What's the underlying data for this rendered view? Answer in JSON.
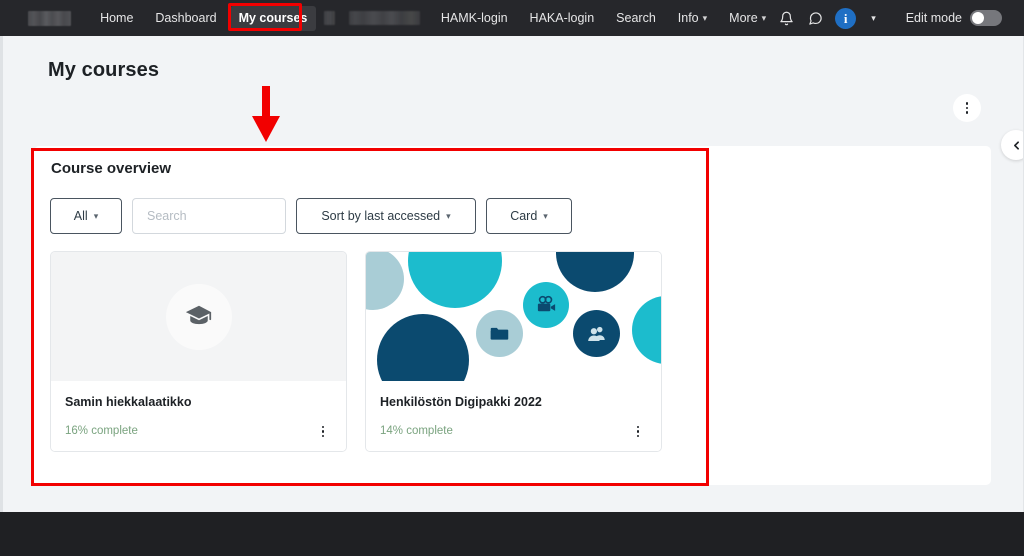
{
  "navbar": {
    "brand": {
      "icon": "redacted-logo-block",
      "redacted": true
    },
    "items": [
      {
        "label": "Home",
        "active": false,
        "has_caret": false
      },
      {
        "label": "Dashboard",
        "active": false,
        "has_caret": false
      },
      {
        "label": "My courses",
        "active": true,
        "has_caret": false
      },
      {
        "label": "HAMK-login",
        "active": false,
        "has_caret": false
      },
      {
        "label": "HAKA-login",
        "active": false,
        "has_caret": false
      },
      {
        "label": "Search",
        "active": false,
        "has_caret": false
      },
      {
        "label": "Info",
        "active": false,
        "has_caret": true
      },
      {
        "label": "More",
        "active": false,
        "has_caret": true
      }
    ],
    "redacted_item": {
      "redacted": true
    },
    "notifications_icon": "bell-icon",
    "messages_icon": "speech-bubble-icon",
    "avatar": {
      "letter": "i",
      "color": "#1f6fc4"
    },
    "avatar_caret": "⌄",
    "edit_mode": {
      "label": "Edit mode",
      "enabled": false
    }
  },
  "page": {
    "title": "My courses",
    "kebab_icon": "kebab-menu-icon",
    "drawer_toggle_icon": "chevron-left-icon"
  },
  "overview": {
    "title": "Course overview",
    "filter_all": {
      "label": "All",
      "caret": "⌄"
    },
    "search": {
      "value": "",
      "placeholder": "Search"
    },
    "sort": {
      "label": "Sort by last accessed",
      "caret": "⌄"
    },
    "view": {
      "label": "Card",
      "caret": "⌄"
    },
    "cards": [
      {
        "title": "Samin hiekkalaatikko",
        "progress": "16% complete",
        "image_type": "placeholder-graduation-cap",
        "image_icon": "graduation-cap-icon",
        "kebab_icon": "kebab-menu-icon"
      },
      {
        "title": "Henkilöstön Digipakki 2022",
        "progress": "14% complete",
        "image_type": "decorative-blobs",
        "image_icons": [
          "folder-icon",
          "video-camera-icon",
          "people-icon"
        ],
        "kebab_icon": "kebab-menu-icon"
      }
    ]
  },
  "annotations": {
    "highlight_box_color": "#f20000",
    "arrow_color": "#f20000",
    "nav_highlight_target": "My courses",
    "box_target": "Course overview"
  },
  "colors": {
    "navbar_bg": "#26272b",
    "page_bg": "#f2f4f6",
    "panel_bg": "#ffffff",
    "accent_teal": "#1cbccd",
    "accent_navy": "#0b4a6f",
    "accent_pale": "#a9cdd6",
    "progress_green": "#7aa37f",
    "annotation_red": "#f20000"
  }
}
